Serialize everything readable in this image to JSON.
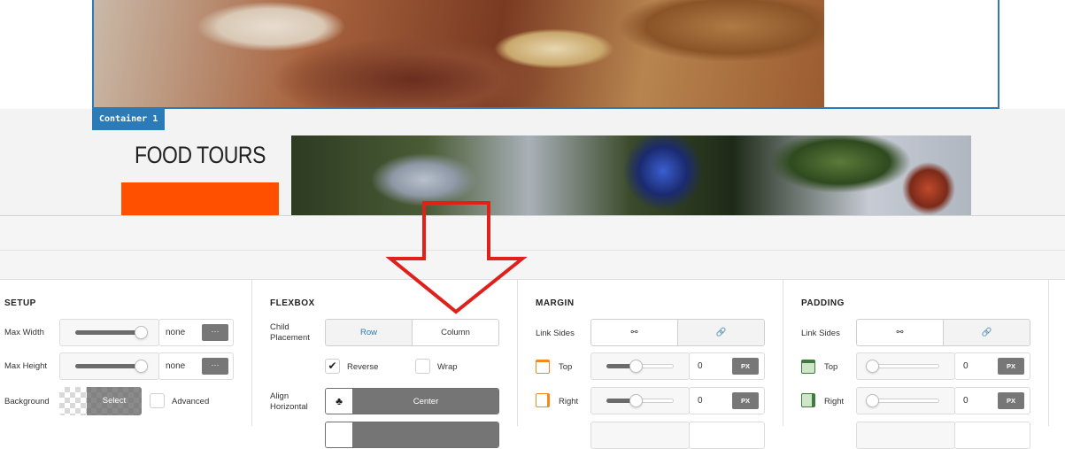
{
  "canvas": {
    "container_label": "Container 1",
    "heading": "FOOD TOURS"
  },
  "setup": {
    "title": "SETUP",
    "max_width_label": "Max Width",
    "max_width_value": "none",
    "max_width_fill": 0.95,
    "max_height_label": "Max Height",
    "max_height_value": "none",
    "max_height_fill": 0.95,
    "more_label": "···",
    "background_label": "Background",
    "select_label": "Select",
    "advanced_label": "Advanced"
  },
  "flexbox": {
    "title": "FLEXBOX",
    "child_placement_label": "Child Placement",
    "row_label": "Row",
    "column_label": "Column",
    "reverse_label": "Reverse",
    "reverse_checked": true,
    "wrap_label": "Wrap",
    "wrap_checked": false,
    "align_horizontal_label": "Align Horizontal",
    "align_horizontal_value": "Center"
  },
  "margin": {
    "title": "MARGIN",
    "link_sides_label": "Link Sides",
    "top_label": "Top",
    "top_value": "0",
    "right_label": "Right",
    "right_value": "0",
    "unit": "PX"
  },
  "padding": {
    "title": "PADDING",
    "link_sides_label": "Link Sides",
    "top_label": "Top",
    "top_value": "0",
    "right_label": "Right",
    "right_value": "0",
    "unit": "PX"
  },
  "colors": {
    "accent_blue": "#2b7bb9",
    "orange": "#ff5000",
    "annotation_red": "#e0201b"
  }
}
